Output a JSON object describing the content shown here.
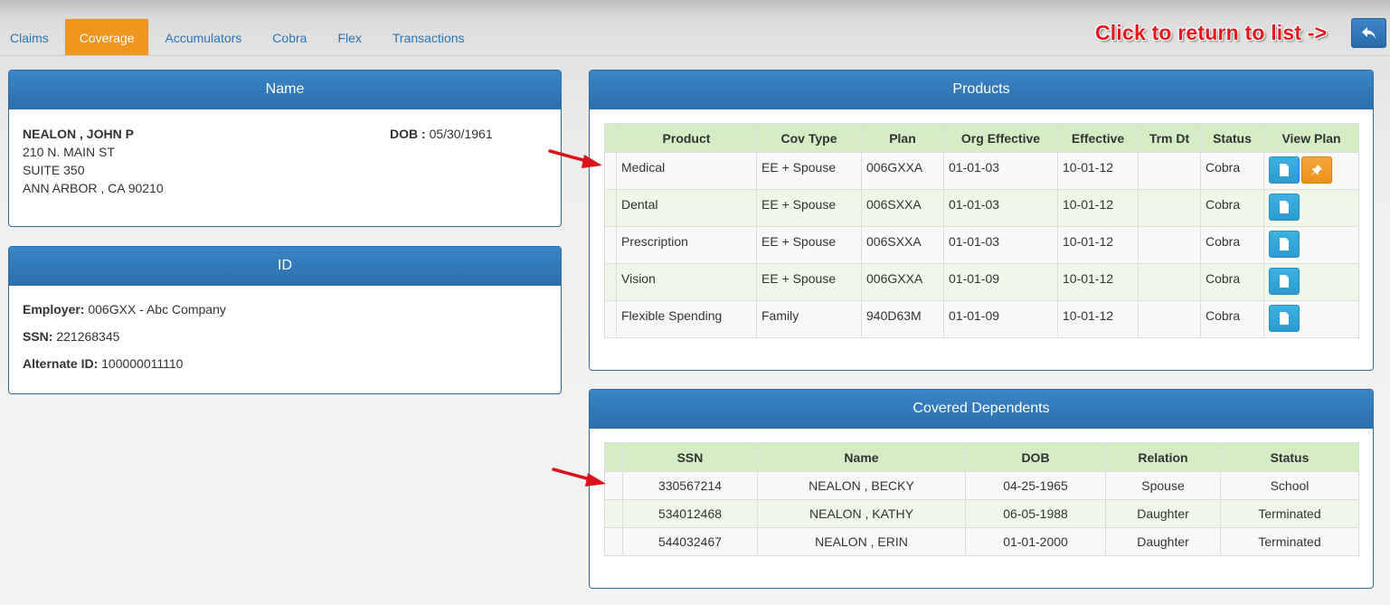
{
  "tabs": [
    {
      "label": "Claims",
      "active": false
    },
    {
      "label": "Coverage",
      "active": true
    },
    {
      "label": "Accumulators",
      "active": false
    },
    {
      "label": "Cobra",
      "active": false
    },
    {
      "label": "Flex",
      "active": false
    },
    {
      "label": "Transactions",
      "active": false
    }
  ],
  "return_hint": "Click to return to list ->",
  "return_button_icon": "reply-arrow-icon",
  "name_panel": {
    "title": "Name",
    "name": "NEALON , JOHN P",
    "address_1": "210 N. MAIN ST",
    "address_2": "SUITE 350",
    "city_state_zip": "ANN ARBOR , CA 90210",
    "dob_label": "DOB :",
    "dob_value": "05/30/1961"
  },
  "id_panel": {
    "title": "ID",
    "employer_label": "Employer:",
    "employer_value": "006GXX - Abc Company",
    "ssn_label": "SSN:",
    "ssn_value": "221268345",
    "alt_id_label": "Alternate ID:",
    "alt_id_value": "100000011110"
  },
  "products_panel": {
    "title": "Products",
    "columns": [
      "Product",
      "Cov Type",
      "Plan",
      "Org Effective",
      "Effective",
      "Trm Dt",
      "Status",
      "View Plan"
    ],
    "rows": [
      {
        "product": "Medical",
        "cov_type": "EE + Spouse",
        "plan": "006GXXA",
        "org_effective": "01-01-03",
        "effective": "10-01-12",
        "trm_dt": "",
        "status": "Cobra",
        "has_pin": true
      },
      {
        "product": "Dental",
        "cov_type": "EE + Spouse",
        "plan": "006SXXA",
        "org_effective": "01-01-03",
        "effective": "10-01-12",
        "trm_dt": "",
        "status": "Cobra",
        "has_pin": false
      },
      {
        "product": "Prescription",
        "cov_type": "EE + Spouse",
        "plan": "006SXXA",
        "org_effective": "01-01-03",
        "effective": "10-01-12",
        "trm_dt": "",
        "status": "Cobra",
        "has_pin": false
      },
      {
        "product": "Vision",
        "cov_type": "EE + Spouse",
        "plan": "006GXXA",
        "org_effective": "01-01-09",
        "effective": "10-01-12",
        "trm_dt": "",
        "status": "Cobra",
        "has_pin": false
      },
      {
        "product": "Flexible Spending",
        "cov_type": "Family",
        "plan": "940D63M",
        "org_effective": "01-01-09",
        "effective": "10-01-12",
        "trm_dt": "",
        "status": "Cobra",
        "has_pin": false
      }
    ]
  },
  "dependents_panel": {
    "title": "Covered Dependents",
    "columns": [
      "SSN",
      "Name",
      "DOB",
      "Relation",
      "Status"
    ],
    "rows": [
      {
        "ssn": "330567214",
        "name": "NEALON , BECKY",
        "dob": "04-25-1965",
        "relation": "Spouse",
        "status": "School"
      },
      {
        "ssn": "534012468",
        "name": "NEALON , KATHY",
        "dob": "06-05-1988",
        "relation": "Daughter",
        "status": "Terminated"
      },
      {
        "ssn": "544032467",
        "name": "NEALON , ERIN",
        "dob": "01-01-2000",
        "relation": "Daughter",
        "status": "Terminated"
      }
    ]
  },
  "colors": {
    "tab_active": "#f0951d",
    "panel_header": "#2e6da4",
    "table_header": "#d4edc4",
    "hint_text": "#e8161b",
    "view_button": "#2b9bd0",
    "pin_button": "#ec921a"
  }
}
